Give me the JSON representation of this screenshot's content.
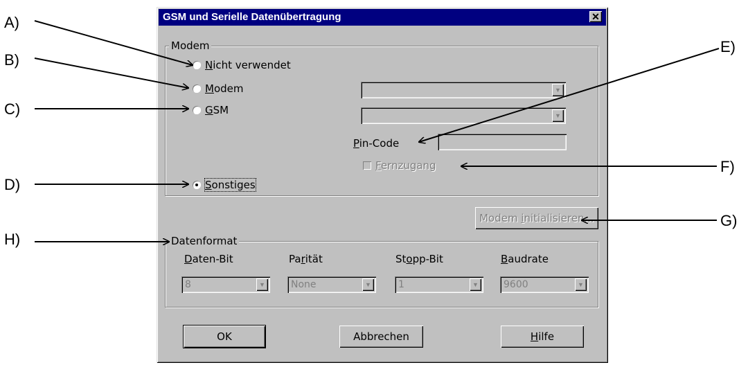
{
  "callouts": {
    "a": "A)",
    "b": "B)",
    "c": "C)",
    "d": "D)",
    "e": "E)",
    "f": "F)",
    "g": "G)",
    "h": "H)"
  },
  "dialog": {
    "title": "GSM und Serielle Datenübertragung",
    "close_glyph": "✕"
  },
  "modem_group": {
    "legend": "Modem",
    "options": [
      {
        "mnemonic": "N",
        "rest": "icht verwendet",
        "selected": false
      },
      {
        "mnemonic": "M",
        "rest": "odem",
        "selected": false
      },
      {
        "mnemonic": "G",
        "rest": "SM",
        "selected": false
      },
      {
        "mnemonic": "S",
        "rest": "onstiges",
        "selected": true
      }
    ],
    "modem_combo_value": "",
    "gsm_combo_value": "",
    "pin_label_mnemonic": "P",
    "pin_label_rest": "in-Code",
    "pin_value": "",
    "fernzugang_mnemonic": "F",
    "fernzugang_rest": "ernzugang",
    "fernzugang_checked": false
  },
  "init_button": {
    "before": "Modem ",
    "mnemonic": "i",
    "after": "nitialisieren..."
  },
  "datenformat_group": {
    "legend": "Datenformat",
    "fields": [
      {
        "mnemonic": "D",
        "rest": "aten-Bit",
        "value": "8"
      },
      {
        "pre": "Pa",
        "mnemonic": "r",
        "rest": "ität",
        "value": "None"
      },
      {
        "pre": "St",
        "mnemonic": "o",
        "rest": "pp-Bit",
        "value": "1"
      },
      {
        "mnemonic": "B",
        "rest": "audrate",
        "value": "9600"
      }
    ]
  },
  "buttons": {
    "ok": "OK",
    "cancel": "Abbrechen",
    "help_mnemonic": "H",
    "help_rest": "ilfe"
  },
  "colors": {
    "window_face": "#c0c0c0",
    "title_bar": "#000080",
    "disabled_text": "#808080"
  }
}
